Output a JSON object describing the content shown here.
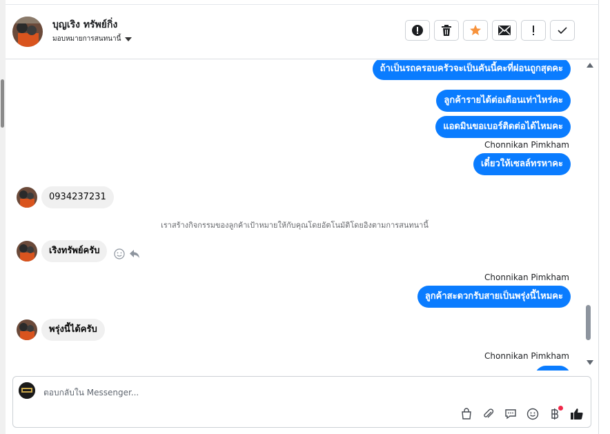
{
  "header": {
    "contact_name": "บุญเริง ทรัพย์กิ่ง",
    "assign_label": "มอบหมายการสนทนานี้",
    "actions": [
      "spam-icon",
      "trash-icon",
      "star-icon",
      "mail-icon",
      "exclamation-icon",
      "check-icon"
    ],
    "star_color": "#f7923b"
  },
  "thread": {
    "out_color": "#0a7cff",
    "messages": {
      "m1": "ถ้าเป็นรถครอบครัวจะเป็นคันนี้คะที่ผ่อนถูกสุดคะ",
      "m2": "ลูกค้ารายได้ต่อเดือนเท่าไหร่คะ",
      "m3": "แอดมินขอเบอร์ติดต่อได้ไหมคะ",
      "sender1": "Chonnikan Pimkham",
      "m4": "เดี๋ยวให้เซลล์ทรหาคะ",
      "in1": "0934237231",
      "system": "เราสร้างกิจกรรมของลูกค้าเป้าหมายให้กับคุณโดยอัตโนมัติโดยอิงตามการสนทนานี้",
      "in2": "เริงทรัพย์ครับ",
      "sender2": "Chonnikan Pimkham",
      "m5": "ลูกค้าสะดวกรับสายเป็นพรุ่งนี้ไหมคะ",
      "in3": "พรุ่งนี้ได้ครับ",
      "sender3": "Chonnikan Pimkham"
    }
  },
  "composer": {
    "placeholder": "ตอบกลับใน Messenger...",
    "tools": [
      "bag-icon",
      "attachment-icon",
      "saved-reply-icon",
      "emoji-icon",
      "baht-icon",
      "like-icon"
    ]
  }
}
